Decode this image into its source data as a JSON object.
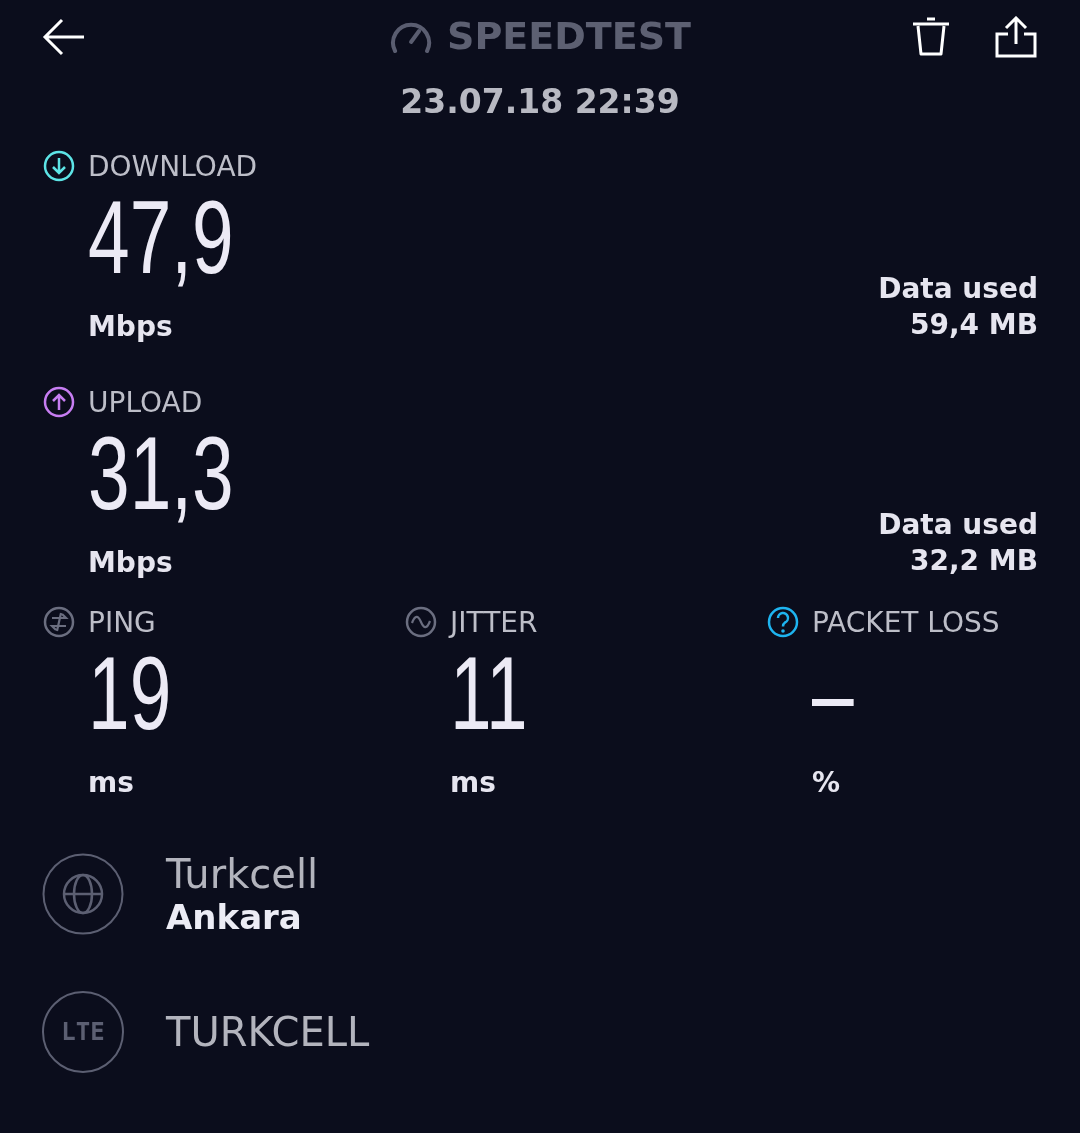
{
  "header": {
    "title": "SPEEDTEST",
    "datetime": "23.07.18 22:39"
  },
  "speeds": [
    {
      "kind": "download",
      "label": "DOWNLOAD",
      "color": "#5de4e6",
      "value": "47,9",
      "unit": "Mbps",
      "data_label": "Data used",
      "data_value": "59,4 MB"
    },
    {
      "kind": "upload",
      "label": "UPLOAD",
      "color": "#c77df2",
      "value": "31,3",
      "unit": "Mbps",
      "data_label": "Data used",
      "data_value": "32,2 MB"
    }
  ],
  "metrics": [
    {
      "kind": "ping",
      "label": "PING",
      "color": "#6b6e80",
      "value": "19",
      "unit": "ms"
    },
    {
      "kind": "jitter",
      "label": "JITTER",
      "color": "#6b6e80",
      "value": "11",
      "unit": "ms"
    },
    {
      "kind": "packet_loss",
      "label": "PACKET LOSS",
      "color": "#1eb4f0",
      "value": "–",
      "unit": "%"
    }
  ],
  "server": {
    "provider": "Turkcell",
    "location": "Ankara"
  },
  "network": {
    "badge": "LTE",
    "carrier": "TURKCELL"
  }
}
